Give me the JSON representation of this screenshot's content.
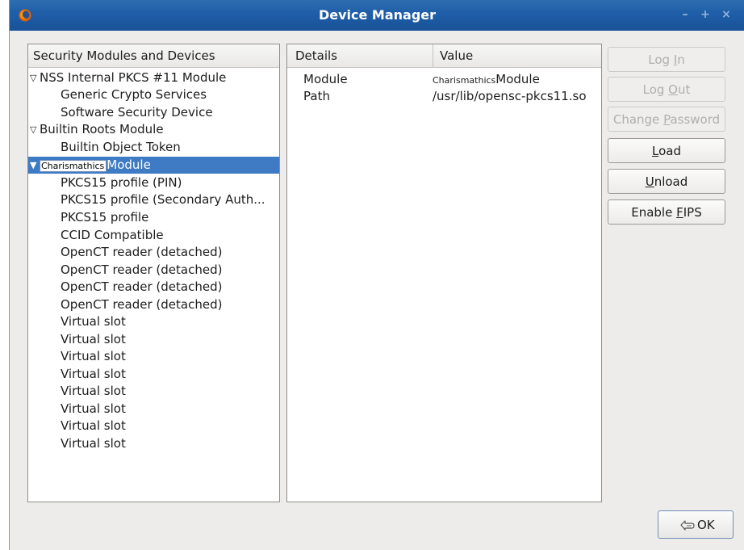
{
  "window": {
    "title": "Device Manager",
    "icons": {
      "app": "firefox-logo-icon",
      "minimize": "minimize-icon",
      "maximize": "maximize-icon",
      "close": "close-icon"
    },
    "wm": {
      "minimize": "–",
      "maximize": "+",
      "close": "×"
    }
  },
  "tree": {
    "header": "Security Modules and Devices",
    "modules": [
      {
        "label": "NSS Internal PKCS #11 Module",
        "expanded": true,
        "children": [
          "Generic Crypto Services",
          "Software Security Device"
        ]
      },
      {
        "label": "Builtin Roots Module",
        "expanded": true,
        "children": [
          "Builtin Object Token"
        ]
      },
      {
        "label_small": "Charismathics",
        "label_rest": "Module",
        "expanded": true,
        "selected": true,
        "children": [
          "PKCS15 profile (PIN)",
          "PKCS15 profile (Secondary Auth...",
          "PKCS15 profile",
          "CCID Compatible",
          "OpenCT reader (detached)",
          "OpenCT reader (detached)",
          "OpenCT reader (detached)",
          "OpenCT reader (detached)",
          "Virtual slot",
          "Virtual slot",
          "Virtual slot",
          "Virtual slot",
          "Virtual slot",
          "Virtual slot",
          "Virtual slot",
          "Virtual slot"
        ]
      }
    ]
  },
  "details": {
    "header_details": "Details",
    "header_value": "Value",
    "rows": [
      {
        "label": "Module",
        "value_small": "Charismathics",
        "value": "Module"
      },
      {
        "label": "Path",
        "value_small": "",
        "value": "/usr/lib/opensc-pkcs11.so"
      }
    ]
  },
  "buttons": {
    "login": {
      "pre": "Log ",
      "mnemonic": "I",
      "post": "n",
      "enabled": false
    },
    "logout": {
      "pre": "Log ",
      "mnemonic": "O",
      "post": "ut",
      "enabled": false
    },
    "change_password": {
      "pre": "Change ",
      "mnemonic": "P",
      "post": "assword",
      "enabled": false
    },
    "load": {
      "pre": "",
      "mnemonic": "L",
      "post": "oad",
      "enabled": true
    },
    "unload": {
      "pre": "",
      "mnemonic": "U",
      "post": "nload",
      "enabled": true
    },
    "enable_fips": {
      "pre": "Enable ",
      "mnemonic": "F",
      "post": "IPS",
      "enabled": true
    },
    "ok": {
      "label": "OK",
      "icon": "ok-hand-icon"
    }
  },
  "colors": {
    "titlebar": "#1f5ea8",
    "selection": "#3e7bc4",
    "disabled_text": "#b0afac"
  }
}
